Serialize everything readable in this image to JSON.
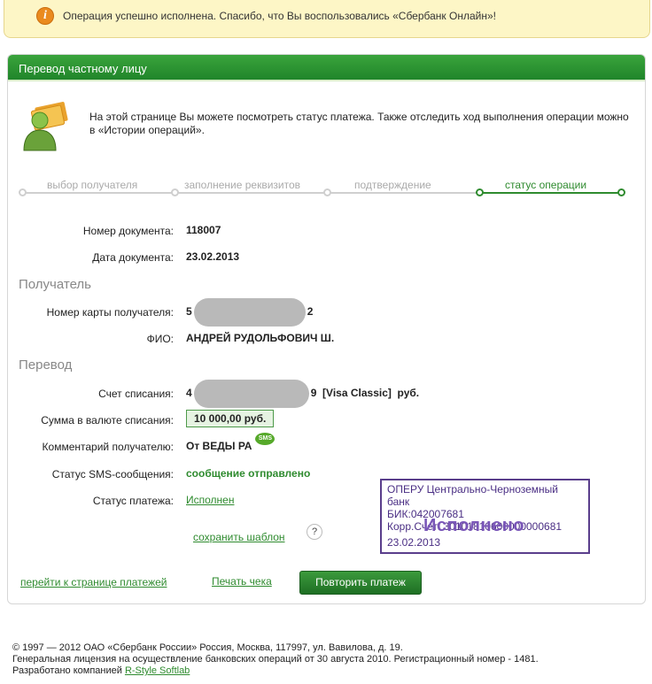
{
  "notice": {
    "icon": "info-icon",
    "icon_glyph": "i",
    "text": "Операция успешно исполнена. Спасибо, что Вы воспользовались «Сбербанк Онлайн»!"
  },
  "panel": {
    "title": "Перевод частному лицу",
    "intro": "На этой странице Вы можете посмотреть статус платежа. Также отследить ход выполнения операции можно в «Истории операций»."
  },
  "steps": [
    {
      "label": "выбор получателя",
      "active": false
    },
    {
      "label": "заполнение реквизитов",
      "active": false
    },
    {
      "label": "подтверждение",
      "active": false
    },
    {
      "label": "статус операции",
      "active": true
    }
  ],
  "document": {
    "number_label": "Номер документа:",
    "number": "118007",
    "date_label": "Дата документа:",
    "date": "23.02.2013"
  },
  "recipient": {
    "section_title": "Получатель",
    "card_label": "Номер карты получателя:",
    "card_prefix": "5",
    "card_suffix": "2",
    "name_label": "ФИО:",
    "name": "АНДРЕЙ РУДОЛЬФОВИЧ Ш."
  },
  "transfer": {
    "section_title": "Перевод",
    "account_label": "Счет списания:",
    "account_prefix": "4",
    "account_suffix": "9",
    "account_type": "[Visa Classic]",
    "account_currency": "руб.",
    "amount_label": "Сумма в валюте списания:",
    "amount": "10 000,00  руб.",
    "comment_label": "Комментарий получателю:",
    "comment": "От ВЕДЫ РА",
    "sms_badge": "SMS",
    "sms_status_label": "Статус SMS-сообщения:",
    "sms_status": "сообщение отправлено",
    "payment_status_label": "Статус платежа:",
    "payment_status": "Исполнен"
  },
  "stamp": {
    "bank": "ОПЕРУ Центрально-Черноземный банк",
    "bik": "БИК:042007681",
    "corr": "Корр.Счет: 30101810600000000681",
    "status": "Исполнено",
    "date": "23.02.2013"
  },
  "actions": {
    "save_template": "сохранить шаблон",
    "help_glyph": "?",
    "to_payments": "перейти к странице платежей",
    "print_receipt": "Печать чека",
    "repeat_payment": "Повторить платеж"
  },
  "footer": {
    "line1": "© 1997 — 2012 ОАО «Сбербанк России» Россия, Москва, 117997, ул. Вавилова, д. 19.",
    "line2": "Генеральная лицензия на осуществление банковских операций от 30 августа 2010. Регистрационный номер - 1481.",
    "line3_prefix": "Разработано компанией",
    "developer": "R-Style Softlab"
  },
  "colors": {
    "brand_green": "#2f8b2f",
    "notice_bg": "#fdf6c6",
    "stamp_purple": "#5a3e8c"
  }
}
